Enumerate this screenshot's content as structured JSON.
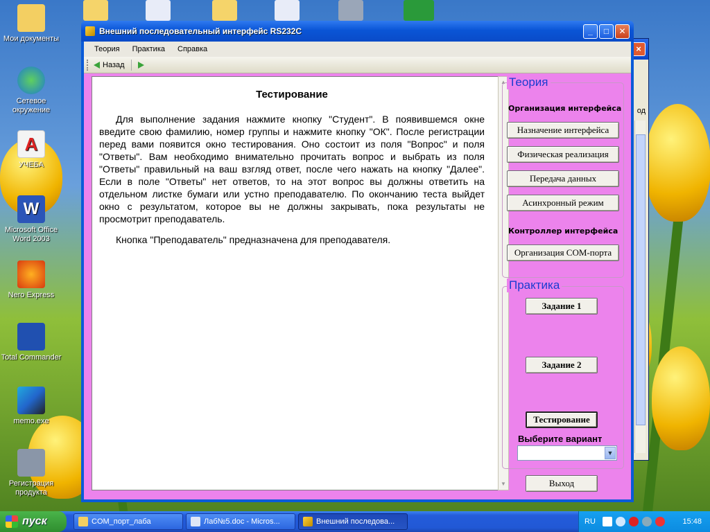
{
  "desktop": {
    "icons": [
      {
        "label": "Мои документы"
      },
      {
        "label": "Сетевое окружение"
      },
      {
        "label": "УЧЕБА"
      },
      {
        "label": "Microsoft Office Word 2003"
      },
      {
        "label": "Nero Express"
      },
      {
        "label": "Total Commander"
      },
      {
        "label": "memo.exe"
      },
      {
        "label": "Регистрация продукта"
      }
    ]
  },
  "window": {
    "title": "Внешний последовательный интерфейс RS232C",
    "menu": [
      "Теория",
      "Практика",
      "Справка"
    ],
    "toolbar": {
      "back_label": "Назад"
    }
  },
  "content": {
    "heading": "Тестирование",
    "paragraphs": [
      "Для выполнение задания нажмите кнопку \"Студент\". В появившемся окне введите свою фамилию, номер группы и нажмите кнопку \"ОК\". После регистрации перед вами появится окно тестирования. Оно состоит из поля \"Вопрос\" и поля \"Ответы\". Вам необходимо внимательно прочитать вопрос и выбрать из поля \"Ответы\" правильный на ваш взгляд ответ, после чего нажать на кнопку \"Далее\". Если в поле \"Ответы\" нет ответов, то на этот вопрос вы должны ответить на отдельном листке бумаги или устно преподавателю. По окончанию теста выйдет окно с результатом, которое вы не должны закрывать, пока результаты не просмотрит преподаватель.",
      "Кнопка \"Преподаватель\" предназначена для преподавателя."
    ]
  },
  "sidebar": {
    "theory": {
      "title": "Теория",
      "section1": "Организация интерфейса",
      "buttons1": [
        "Назначение интерфейса",
        "Физическая реализация",
        "Передача данных",
        "Асинхронный режим"
      ],
      "section2": "Контроллер интерфейса",
      "buttons2": [
        "Организация COM-порта"
      ]
    },
    "practice": {
      "title": "Практика",
      "task1": "Задание 1",
      "task2": "Задание 2",
      "testing": "Тестирование",
      "choose_label": "Выберите вариант",
      "variant_value": ""
    },
    "exit": "Выход"
  },
  "background_window": {
    "fragment": "од"
  },
  "taskbar": {
    "start": "пуск",
    "tasks": [
      "COM_порт_лаба",
      "Лаб№5.doc - Micros...",
      "Внешний последова..."
    ],
    "lang": "RU",
    "time": "15:48"
  }
}
